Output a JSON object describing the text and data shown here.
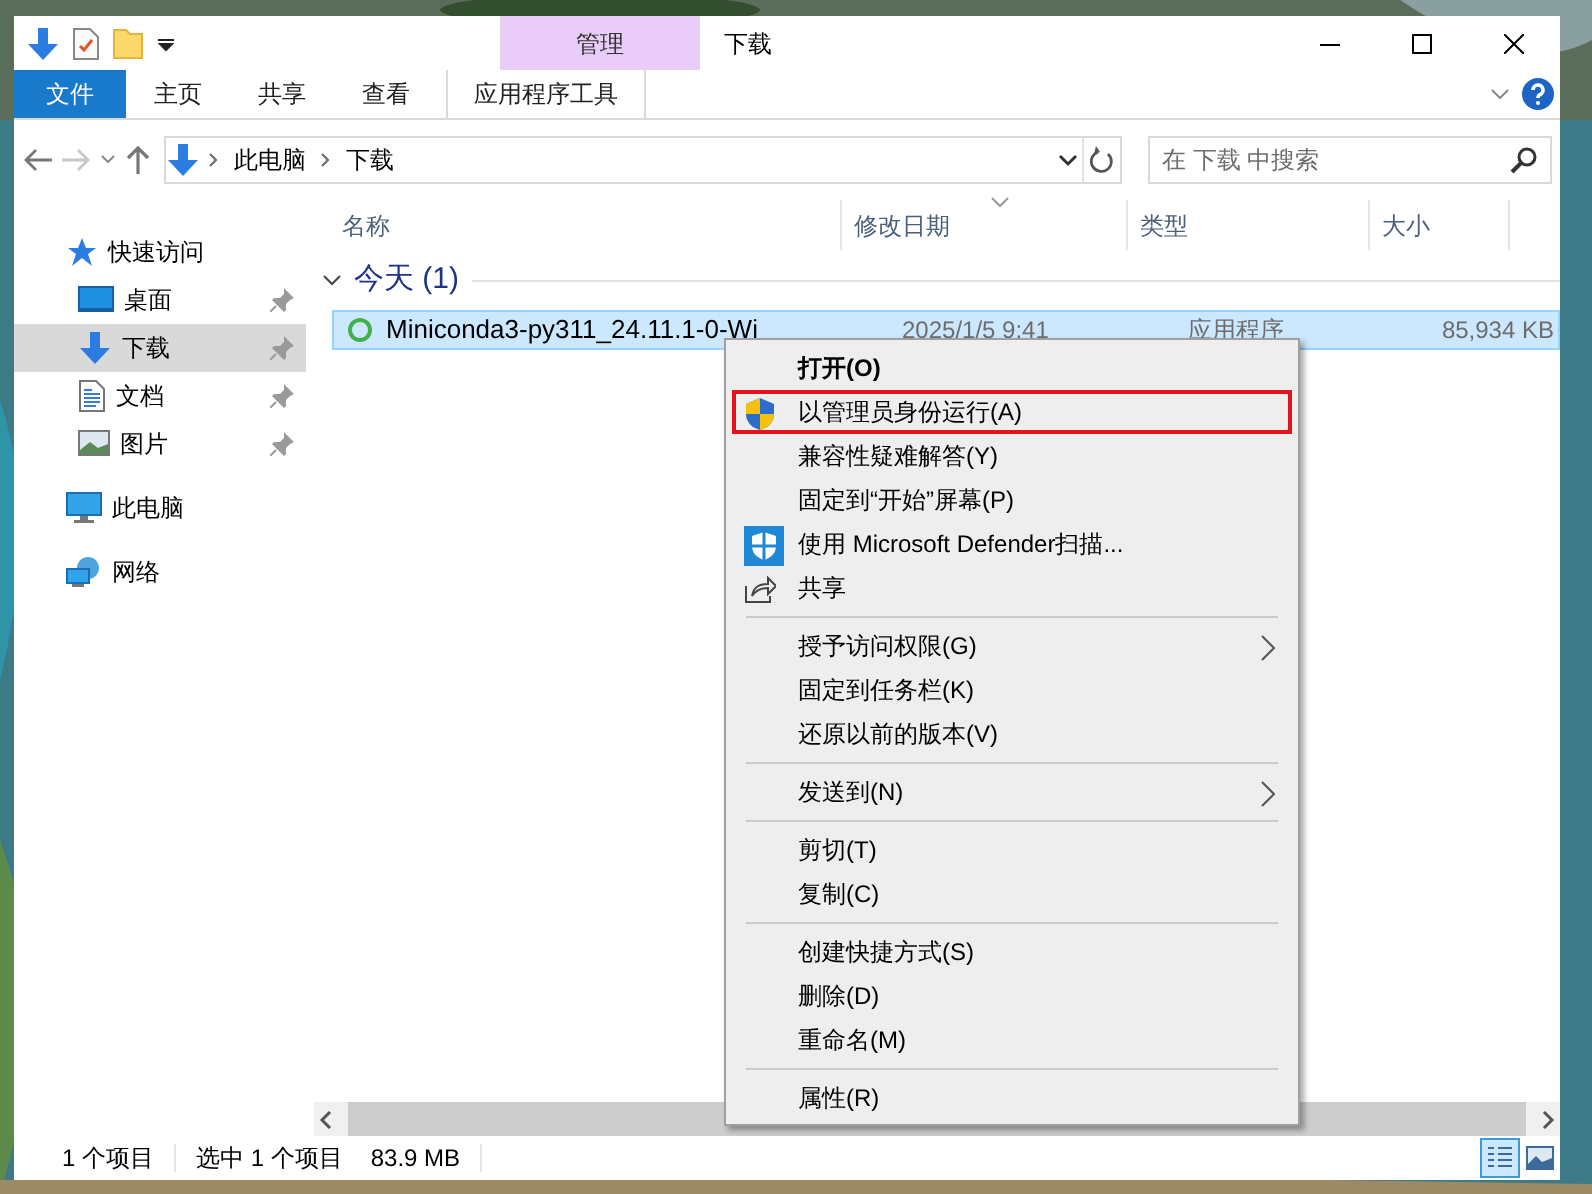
{
  "title_bar": {
    "contextual_tab": "管理",
    "title": "下载"
  },
  "ribbon": {
    "tabs": [
      {
        "label": "文件",
        "kind": "file"
      },
      {
        "label": "主页",
        "kind": "tab"
      },
      {
        "label": "共享",
        "kind": "tab"
      },
      {
        "label": "查看",
        "kind": "tab"
      },
      {
        "label": "应用程序工具",
        "kind": "contextual"
      }
    ]
  },
  "address": {
    "path": [
      "此电脑",
      "下载"
    ]
  },
  "search": {
    "placeholder": "在 下载 中搜索"
  },
  "nav": [
    {
      "label": "快速访问",
      "kind": "star",
      "pinned": false,
      "selected": false,
      "children": [
        {
          "label": "桌面",
          "kind": "desktop",
          "pinned": true,
          "selected": false
        },
        {
          "label": "下载",
          "kind": "download",
          "pinned": true,
          "selected": true
        },
        {
          "label": "文档",
          "kind": "document",
          "pinned": true,
          "selected": false
        },
        {
          "label": "图片",
          "kind": "pictures",
          "pinned": true,
          "selected": false
        }
      ]
    },
    {
      "label": "此电脑",
      "kind": "computer",
      "pinned": false,
      "selected": false
    },
    {
      "label": "网络",
      "kind": "network",
      "pinned": false,
      "selected": false
    }
  ],
  "columns": [
    "名称",
    "修改日期",
    "类型",
    "大小"
  ],
  "groups": [
    {
      "label": "今天 (1)",
      "expanded": true,
      "rows": [
        {
          "name": "Miniconda3-py311_24.11.1-0-Wi",
          "date": "2025/1/5 9:41",
          "type": "应用程序",
          "size": "85,934 KB",
          "selected": true
        }
      ]
    }
  ],
  "context_menu": {
    "items": [
      {
        "kind": "item",
        "label": "打开(O)",
        "default": true,
        "highlighted": false,
        "submenu": false
      },
      {
        "kind": "shield",
        "label": "以管理员身份运行(A)",
        "default": false,
        "highlighted": true,
        "submenu": false
      },
      {
        "kind": "item",
        "label": "兼容性疑难解答(Y)",
        "default": false,
        "highlighted": false,
        "submenu": false
      },
      {
        "kind": "item",
        "label": "固定到“开始”屏幕(P)",
        "default": false,
        "highlighted": false,
        "submenu": false
      },
      {
        "kind": "defender",
        "label": "使用 Microsoft Defender扫描...",
        "default": false,
        "highlighted": false,
        "submenu": false
      },
      {
        "kind": "share",
        "label": "共享",
        "default": false,
        "highlighted": false,
        "submenu": false
      },
      {
        "kind": "separator"
      },
      {
        "kind": "item",
        "label": "授予访问权限(G)",
        "default": false,
        "highlighted": false,
        "submenu": true
      },
      {
        "kind": "item",
        "label": "固定到任务栏(K)",
        "default": false,
        "highlighted": false,
        "submenu": false
      },
      {
        "kind": "item",
        "label": "还原以前的版本(V)",
        "default": false,
        "highlighted": false,
        "submenu": false
      },
      {
        "kind": "separator"
      },
      {
        "kind": "item",
        "label": "发送到(N)",
        "default": false,
        "highlighted": false,
        "submenu": true
      },
      {
        "kind": "separator"
      },
      {
        "kind": "item",
        "label": "剪切(T)",
        "default": false,
        "highlighted": false,
        "submenu": false
      },
      {
        "kind": "item",
        "label": "复制(C)",
        "default": false,
        "highlighted": false,
        "submenu": false
      },
      {
        "kind": "separator"
      },
      {
        "kind": "item",
        "label": "创建快捷方式(S)",
        "default": false,
        "highlighted": false,
        "submenu": false
      },
      {
        "kind": "item",
        "label": "删除(D)",
        "default": false,
        "highlighted": false,
        "submenu": false
      },
      {
        "kind": "item",
        "label": "重命名(M)",
        "default": false,
        "highlighted": false,
        "submenu": false
      },
      {
        "kind": "separator"
      },
      {
        "kind": "item",
        "label": "属性(R)",
        "default": false,
        "highlighted": false,
        "submenu": false
      }
    ]
  },
  "status_bar": {
    "items": [
      "1 个项目",
      "选中 1 个项目",
      "83.9 MB"
    ],
    "views": [
      {
        "kind": "details",
        "selected": true
      },
      {
        "kind": "thumbnails",
        "selected": false
      }
    ]
  }
}
